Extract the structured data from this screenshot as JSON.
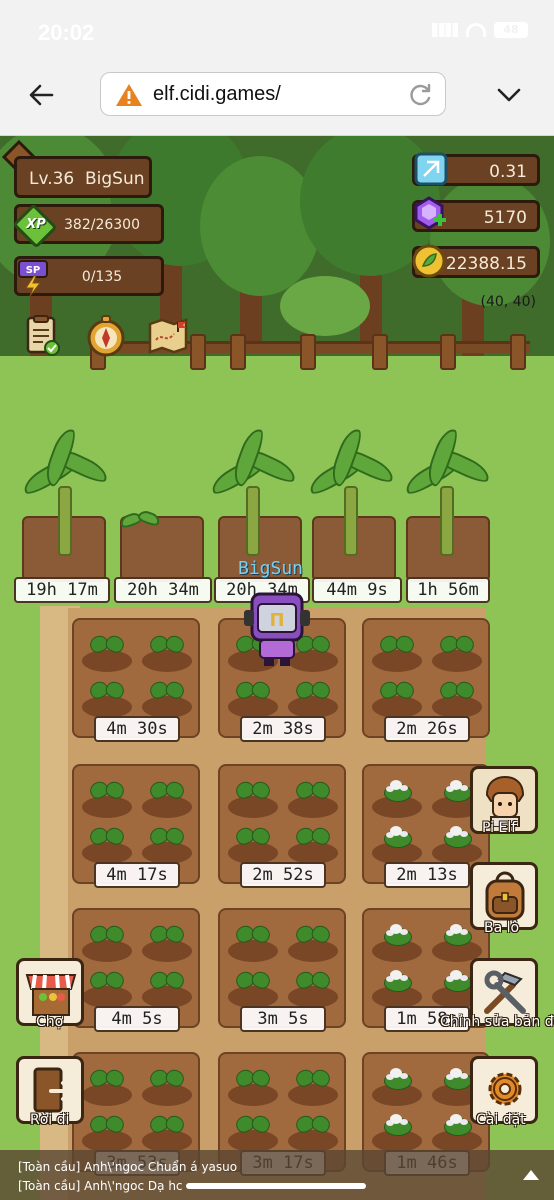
{
  "statusbar": {
    "time": "20:02",
    "battery": "48"
  },
  "browser": {
    "url": "elf.cidi.games/"
  },
  "player": {
    "level": "Lv.36",
    "name": "BigSun",
    "xp": "382/26300",
    "sp": "0/135",
    "xp_badge": "XP",
    "sp_badge": "SP"
  },
  "resources": {
    "crystal": "0.31",
    "gem": "5170",
    "coin": "22388.15"
  },
  "coords": "(40, 40)",
  "banana_timers": [
    "19h 17m",
    "20h 34m",
    "20h 34m",
    "44m 9s",
    "1h 56m"
  ],
  "plot_timers": [
    "4m 30s",
    "2m 38s",
    "2m 26s",
    "4m 17s",
    "2m 52s",
    "2m 13s",
    "4m 5s",
    "3m 5s",
    "1m 58s",
    "3m 53s",
    "3m 17s",
    "1m 46s"
  ],
  "side_buttons": {
    "pi_elf": "Pi Elf",
    "bag": "Ba lô",
    "edit_land": "Chỉnh sửa bản đồ",
    "settings": "Cài đặt",
    "market": "Chợ",
    "leave": "Rời đi"
  },
  "chat": [
    {
      "channel": "[Toàn cầu]",
      "user": "Anh\\'ngoc",
      "message": "Chuẩn á yasuo"
    },
    {
      "channel": "[Toàn cầu]",
      "user": "Anh\\'ngoc",
      "message": "Dạ hc"
    }
  ],
  "colors": {
    "hud_panel": "#6a4223",
    "soil": "#a0693e",
    "grass": "#8ec456"
  },
  "icons": [
    "back-arrow-icon",
    "warning-icon",
    "reload-icon",
    "chevron-down-icon",
    "crystal-icon",
    "gem-icon",
    "coin-icon",
    "quest-icon",
    "compass-icon",
    "map-icon"
  ]
}
